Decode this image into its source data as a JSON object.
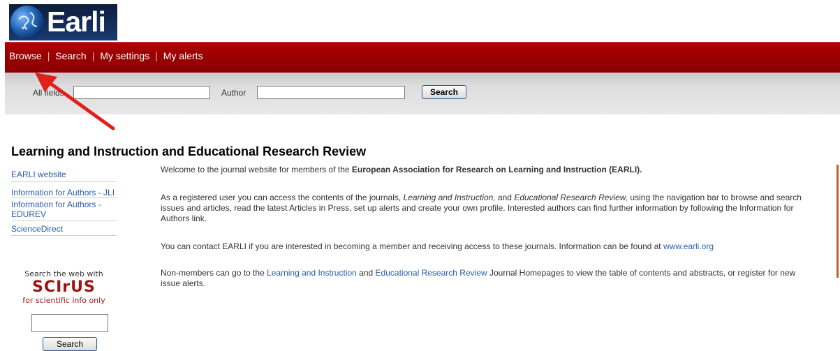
{
  "logo": {
    "text": "Earli"
  },
  "nav": {
    "items": [
      "Browse",
      "Search",
      "My settings",
      "My alerts"
    ],
    "separator": "|"
  },
  "search": {
    "all_fields_label": "All fields",
    "author_label": "Author",
    "all_fields_value": "",
    "author_value": "",
    "button_label": "Search"
  },
  "page_title": "Learning and Instruction and Educational Research Review",
  "sidebar": {
    "items": [
      {
        "label": "EARLI website"
      },
      {
        "label": "Information for Authors - JLI"
      },
      {
        "label": "Information for Authors - EDUREV"
      },
      {
        "label": "ScienceDirect"
      }
    ]
  },
  "scirus": {
    "search_label": "Search the web with",
    "logo_text": "SCIrUS",
    "tagline": "for scientific info only",
    "button_label": "Search"
  },
  "main": {
    "p1_prefix": "Welcome to the journal website for members of the ",
    "p1_bold": "European Association for Research on Learning and Instruction (EARLI).",
    "p2_a": "As a registered user you can access the contents of the journals, ",
    "p2_journal1": "Learning and Instruction,",
    "p2_b": " and ",
    "p2_journal2": "Educational Research Review,",
    "p2_c": " using the navigation bar to browse and search issues and articles, read the latest Articles in Press, set up alerts and create your own profile. Interested authors can find further information by following the Information for Authors link.",
    "p3_text": "You can contact EARLI if you are interested in becoming a member and receiving access to these journals. Information can be found at ",
    "p3_link": "www.earli.org",
    "p4_a": "Non-members can go to the ",
    "p4_link1": "Learning and Instruction",
    "p4_b": " and ",
    "p4_link2": "Educational Research Review",
    "p4_c": " Journal Homepages to view the table of contents and abstracts, or register for new issue alerts."
  },
  "colors": {
    "nav_red": "#9a0000",
    "link_blue": "#2a5db0",
    "arrow_red": "#e0201a",
    "scirus_red": "#9b1510"
  }
}
